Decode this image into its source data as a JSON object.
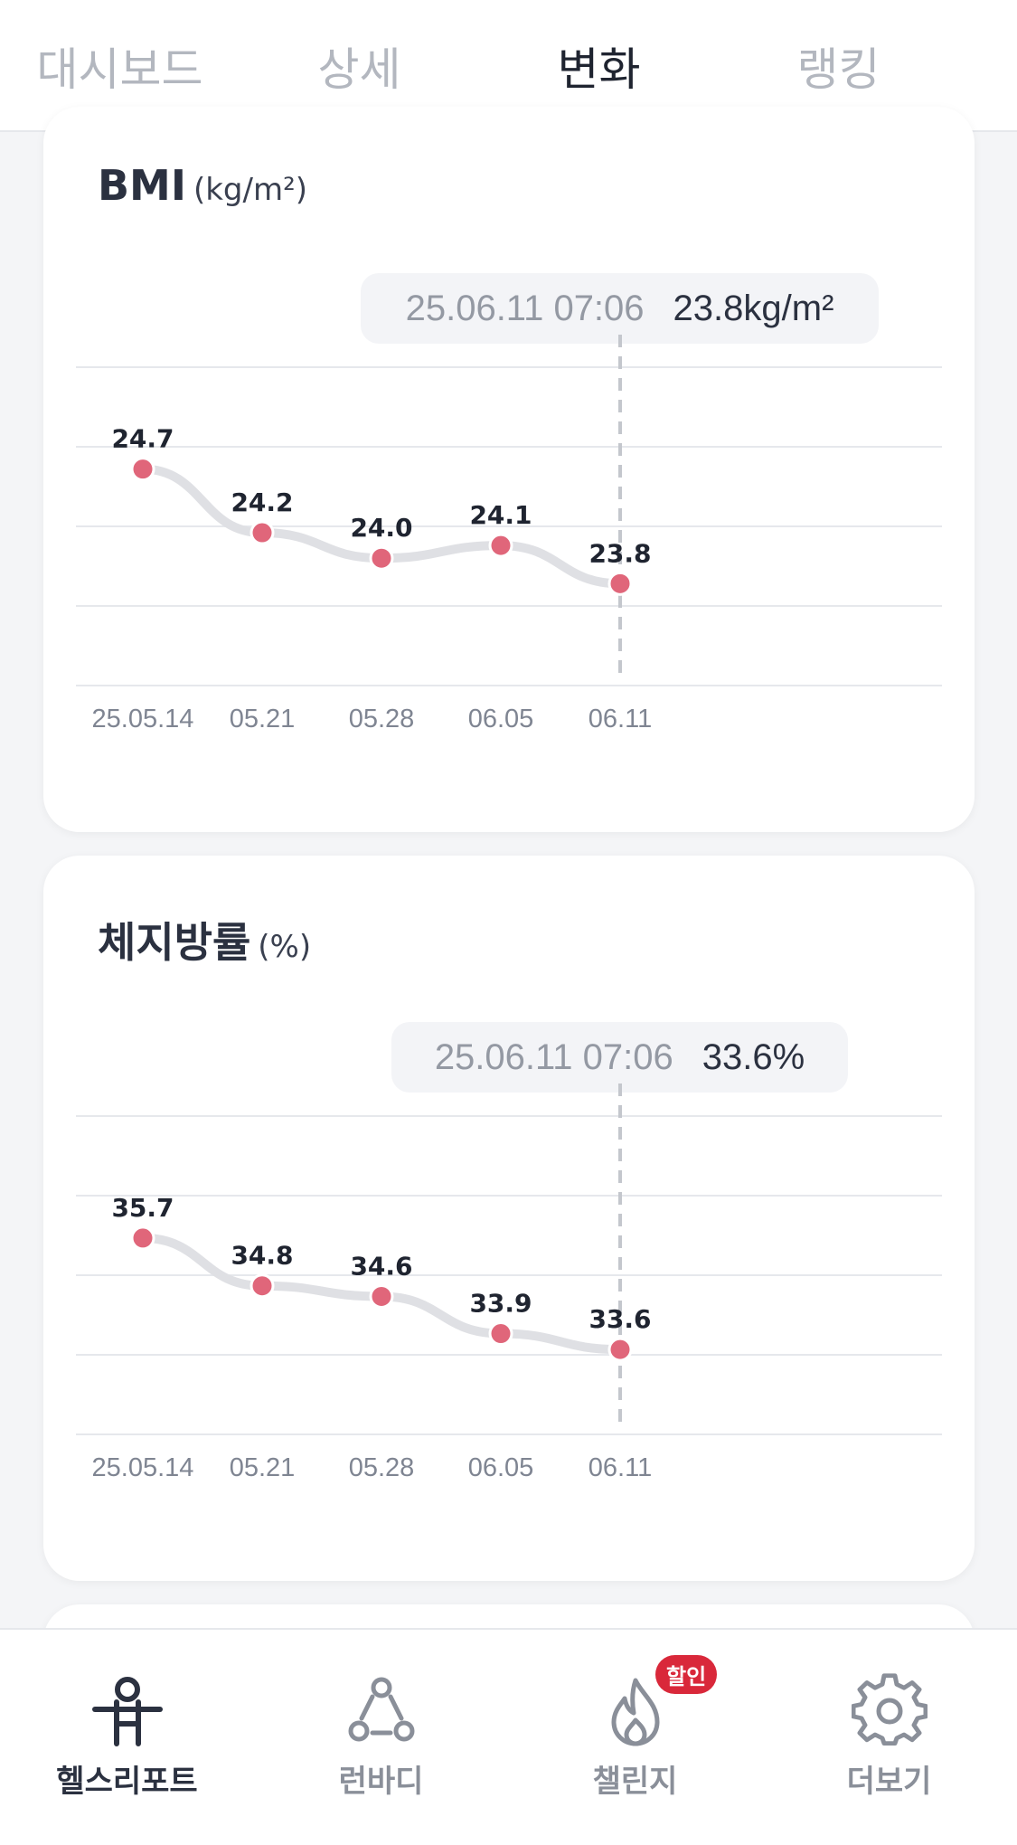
{
  "tabs": [
    "대시보드",
    "상세",
    "변화",
    "랭킹"
  ],
  "active_tab": 2,
  "bmi": {
    "title": "BMI",
    "unit": "(kg/m²)",
    "tooltip_date": "25.06.11 07:06",
    "tooltip_value": "23.8kg/m²"
  },
  "bodyfat": {
    "title": "체지방률",
    "unit": "(%)",
    "tooltip_date": "25.06.11 07:06",
    "tooltip_value": "33.6%"
  },
  "chart_data": [
    {
      "type": "line",
      "title": "BMI",
      "x": [
        "25.05.14",
        "05.21",
        "05.28",
        "06.05",
        "06.11"
      ],
      "values": [
        24.7,
        24.2,
        24.0,
        24.1,
        23.8
      ],
      "value_labels": [
        "24.7",
        "24.2",
        "24.0",
        "24.1",
        "23.8"
      ],
      "ylim": [
        23.0,
        25.5
      ],
      "grid": true,
      "selected_index": 4
    },
    {
      "type": "line",
      "title": "체지방률",
      "x": [
        "25.05.14",
        "05.21",
        "05.28",
        "06.05",
        "06.11"
      ],
      "values": [
        35.7,
        34.8,
        34.6,
        33.9,
        33.6
      ],
      "value_labels": [
        "35.7",
        "34.8",
        "34.6",
        "33.9",
        "33.6"
      ],
      "ylim": [
        32.0,
        38.0
      ],
      "grid": true,
      "selected_index": 4
    }
  ],
  "colors": {
    "point": "#e0667a",
    "line": "#dfe0e4",
    "grid": "#e6e8ec",
    "accent": "#2b3140",
    "badge": "#d9283a"
  },
  "nav": [
    {
      "label": "헬스리포트",
      "icon": "person-icon",
      "active": true
    },
    {
      "label": "런바디",
      "icon": "runbody-icon",
      "active": false
    },
    {
      "label": "챌린지",
      "icon": "flame-icon",
      "active": false,
      "badge": "할인"
    },
    {
      "label": "더보기",
      "icon": "gear-icon",
      "active": false
    }
  ]
}
